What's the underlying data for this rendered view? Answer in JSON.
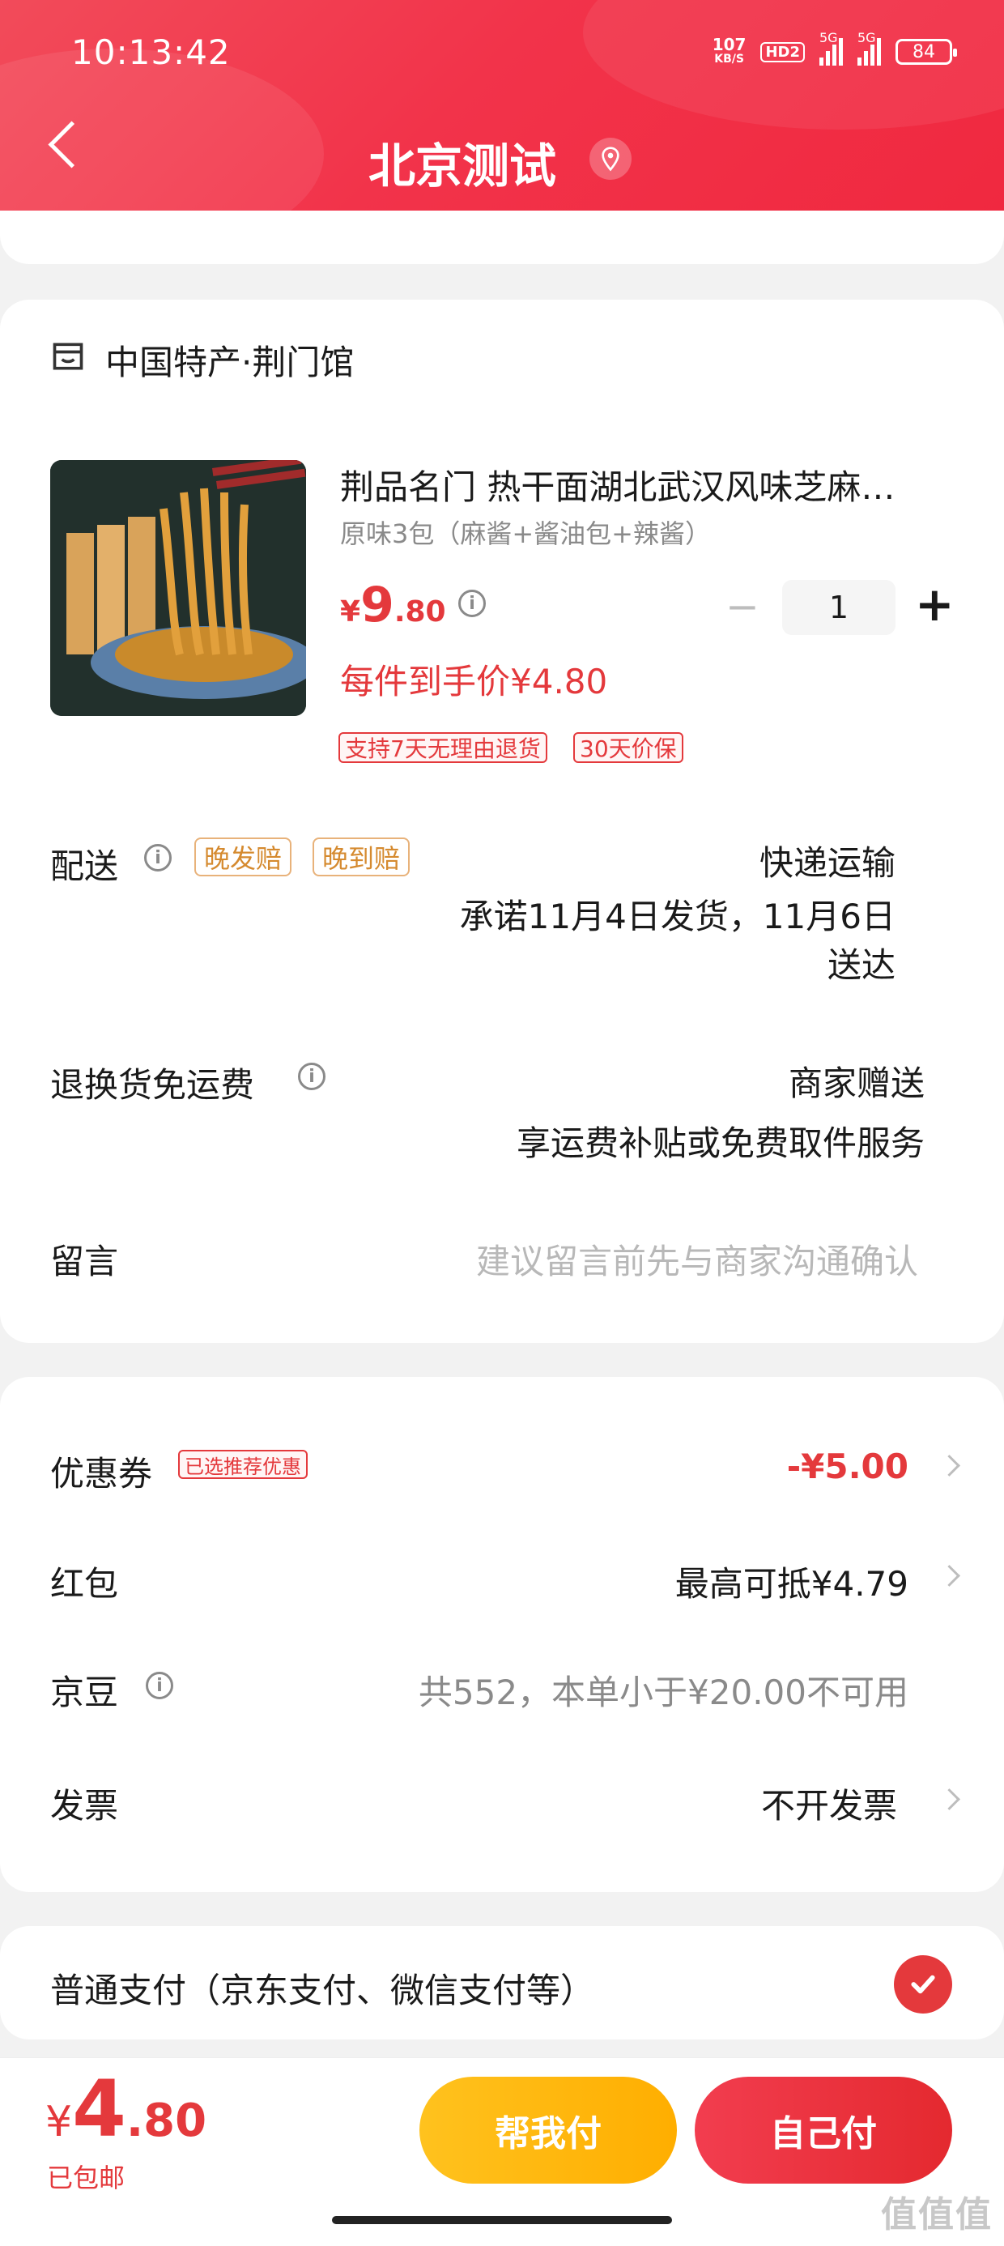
{
  "status_bar": {
    "time": "10:13:42",
    "net_speed_top": "107",
    "net_speed_unit": "KB/S",
    "hd": "HD2",
    "signal1": "5G",
    "signal2": "5G",
    "battery": "84"
  },
  "header": {
    "title": "北京测试"
  },
  "store": {
    "name": "中国特产·荆门馆"
  },
  "product": {
    "title": "荆品名门 热干面湖北武汉风味芝麻…",
    "spec": "原味3包（麻酱+酱油包+辣酱）",
    "price_symbol": "¥",
    "price_int": "9",
    "price_dec": ".80",
    "quantity": "1",
    "per_item_price": "每件到手价¥4.80",
    "tags": [
      "支持7天无理由退货",
      "30天价保"
    ]
  },
  "delivery": {
    "label": "配送",
    "tags": [
      "晚发赔",
      "晚到赔"
    ],
    "method": "快递运输",
    "promise_line1": "承诺11月4日发货，11月6日",
    "promise_line2": "送达"
  },
  "return_freight": {
    "label": "退换货免运费",
    "value": "商家赠送",
    "desc": "享运费补贴或免费取件服务"
  },
  "message": {
    "label": "留言",
    "placeholder": "建议留言前先与商家沟通确认"
  },
  "coupon": {
    "label": "优惠券",
    "tag": "已选推荐优惠",
    "value": "-¥5.00"
  },
  "red_packet": {
    "label": "红包",
    "value": "最高可抵¥4.79"
  },
  "jd_beans": {
    "label": "京豆",
    "value": "共552，本单小于¥20.00不可用"
  },
  "invoice": {
    "label": "发票",
    "value": "不开发票"
  },
  "payment": {
    "label": "普通支付（京东支付、微信支付等）"
  },
  "footer": {
    "total_symbol": "¥",
    "total_int": "4",
    "total_dec": ".80",
    "shipping": "已包邮",
    "help_pay": "帮我付",
    "self_pay": "自己付"
  },
  "watermark": "值值值",
  "colors": {
    "accent": "#e4393c",
    "header": "#f2334a",
    "help_btn": "#ffb400"
  }
}
